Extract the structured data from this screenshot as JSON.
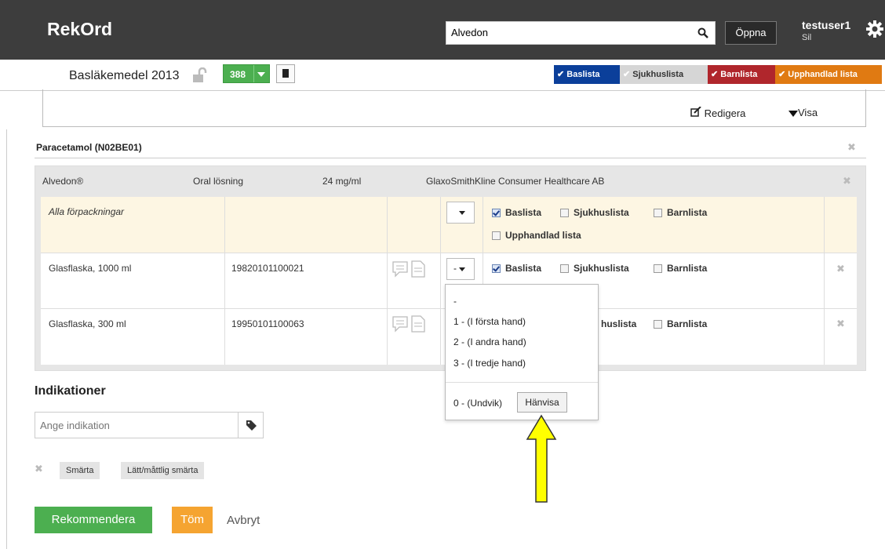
{
  "app": {
    "title": "RekOrd"
  },
  "search": {
    "value": "Alvedon",
    "open_label": "Öppna"
  },
  "user": {
    "name": "testuser1",
    "sub": "Sil"
  },
  "sub": {
    "list_name": "Basläkemedel 2013",
    "count": "388"
  },
  "tags": {
    "baslista": "Baslista",
    "sjukhuslista": "Sjukhuslista",
    "barnlista": "Barnlista",
    "upphandlad": "Upphandlad lista"
  },
  "toolbar": {
    "edit": "Redigera",
    "view": "Visa"
  },
  "substance": {
    "title": "Paracetamol (N02BE01)"
  },
  "product": {
    "name": "Alvedon®",
    "form": "Oral lösning",
    "strength": "24 mg/ml",
    "company": "GlaxoSmithKline Consumer Healthcare AB"
  },
  "rows": [
    {
      "package": "Alla förpackningar",
      "nr": "",
      "level": "",
      "checks": {
        "baslista": true,
        "sjukhuslista": false,
        "barnlista": false,
        "upphandlad": false
      }
    },
    {
      "package": "Glasflaska, 1000 ml",
      "nr": "19820101100021",
      "level": "-",
      "checks": {
        "baslista": true,
        "sjukhuslista": false,
        "barnlista": false
      }
    },
    {
      "package": "Glasflaska, 300 ml",
      "nr": "19950101100063",
      "level": "",
      "checks": {
        "sjukhuslista_partial": "huslista",
        "barnlista": false
      }
    }
  ],
  "labels": {
    "baslista": "Baslista",
    "sjukhuslista": "Sjukhuslista",
    "barnlista": "Barnlista",
    "upphandlad": "Upphandlad lista"
  },
  "menu": {
    "items": [
      "-",
      "1 - (I första hand)",
      "2 - (I andra hand)",
      "3 - (I tredje hand)"
    ],
    "avoid": "0 - (Undvik)",
    "refer": "Hänvisa"
  },
  "indications": {
    "title": "Indikationer",
    "placeholder": "Ange indikation",
    "chips": [
      "Smärta",
      "Lätt/måttlig smärta"
    ]
  },
  "buttons": {
    "recommend": "Rekommendera",
    "clear": "Töm",
    "cancel": "Avbryt"
  },
  "colors": {
    "topbar": "#3d3d3d",
    "green": "#4caf50",
    "blue": "#0b3f9a",
    "red": "#b0262c",
    "orange": "#e07a12",
    "yellow_arrow": "#ffff00"
  }
}
